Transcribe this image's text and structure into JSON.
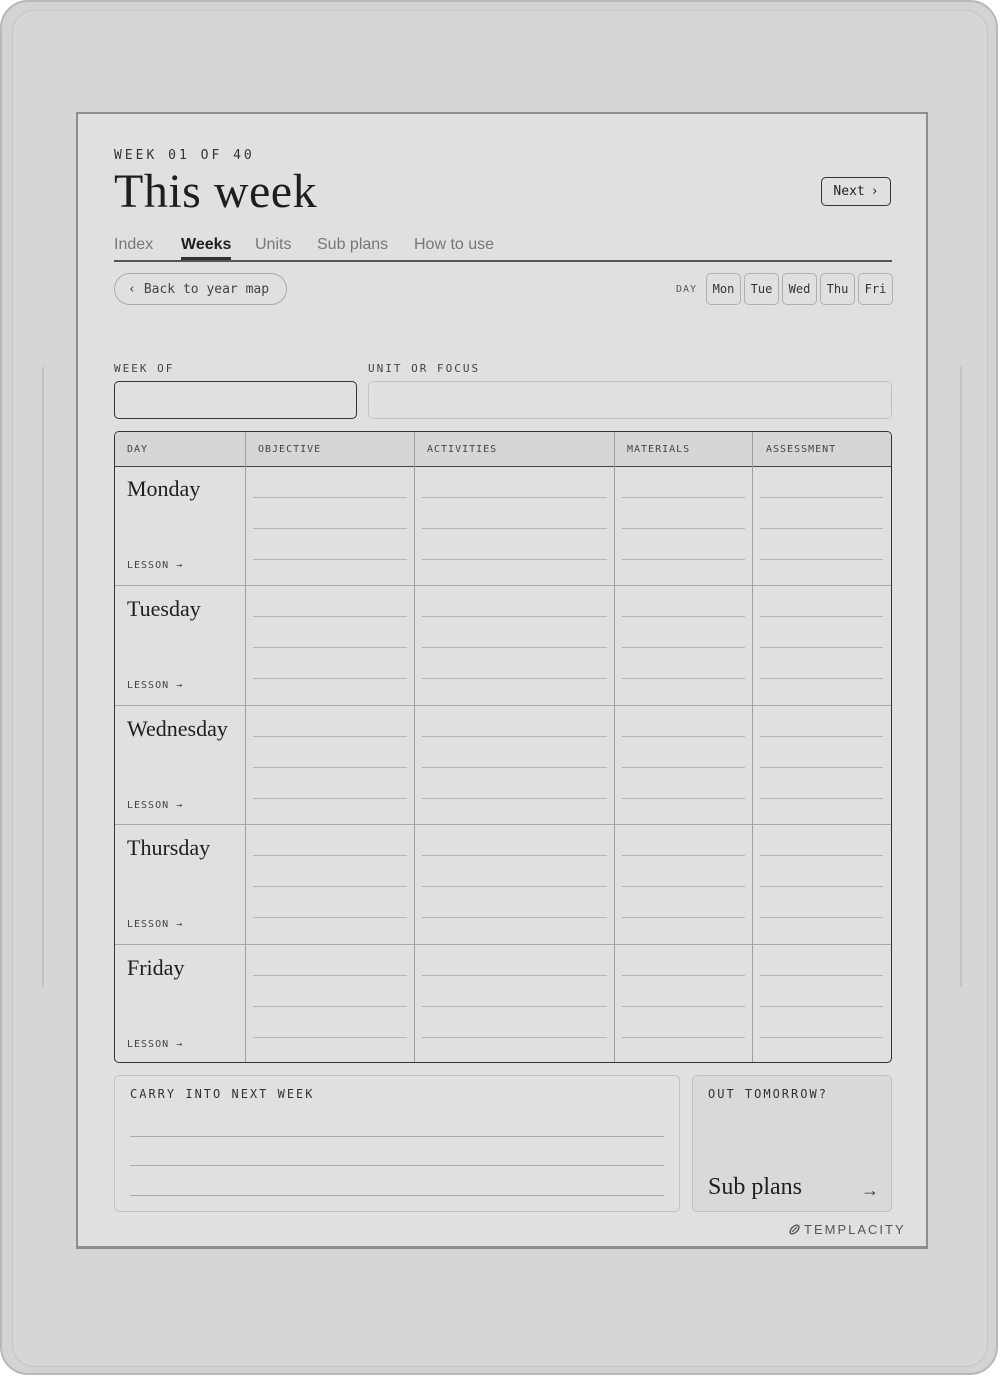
{
  "header": {
    "eyebrow": "WEEK 01 OF 40",
    "title": "This week",
    "next_label": "Next",
    "next_icon": "›"
  },
  "tabs": [
    {
      "label": "Index",
      "active": false
    },
    {
      "label": "Weeks",
      "active": true
    },
    {
      "label": "Units",
      "active": false
    },
    {
      "label": "Sub plans",
      "active": false
    },
    {
      "label": "How to use",
      "active": false
    }
  ],
  "nav": {
    "back_icon": "‹",
    "back_label": "Back to year map",
    "day_label": "DAY",
    "days": [
      "Mon",
      "Tue",
      "Wed",
      "Thu",
      "Fri"
    ]
  },
  "fields": {
    "week_of_label": "WEEK OF",
    "week_of_value": "",
    "unit_label": "UNIT OR FOCUS",
    "unit_value": ""
  },
  "plan": {
    "columns": [
      "DAY",
      "OBJECTIVE",
      "ACTIVITIES",
      "MATERIALS",
      "ASSESSMENT"
    ],
    "rows": [
      {
        "day": "Monday",
        "lesson": "LESSON →"
      },
      {
        "day": "Tuesday",
        "lesson": "LESSON →"
      },
      {
        "day": "Wednesday",
        "lesson": "LESSON →"
      },
      {
        "day": "Thursday",
        "lesson": "LESSON →"
      },
      {
        "day": "Friday",
        "lesson": "LESSON →"
      }
    ]
  },
  "carry": {
    "label": "CARRY INTO NEXT WEEK"
  },
  "out": {
    "label": "OUT TOMORROW?",
    "title": "Sub plans",
    "arrow": "→"
  },
  "brand": {
    "name": "TEMPLACITY",
    "icon": "paperclip-icon"
  }
}
